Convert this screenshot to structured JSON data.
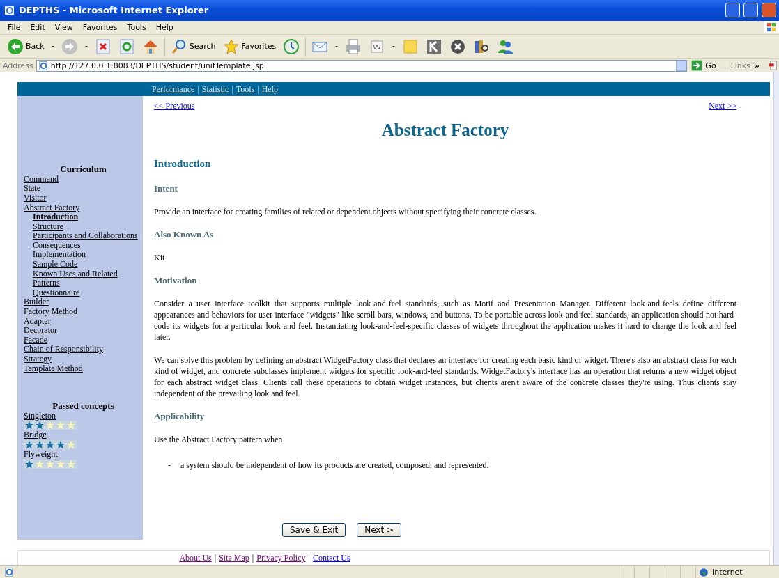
{
  "window": {
    "title": "DEPTHS - Microsoft Internet Explorer"
  },
  "menu_bar": [
    {
      "label": "File"
    },
    {
      "label": "Edit"
    },
    {
      "label": "View"
    },
    {
      "label": "Favorites"
    },
    {
      "label": "Tools"
    },
    {
      "label": "Help"
    }
  ],
  "toolbar": [
    {
      "kind": "back",
      "label": "Back",
      "dropdown": true
    },
    {
      "kind": "forward",
      "dropdown": true
    },
    {
      "kind": "stop"
    },
    {
      "kind": "refresh"
    },
    {
      "kind": "home"
    },
    {
      "kind": "sep"
    },
    {
      "kind": "search",
      "label": "Search"
    },
    {
      "kind": "favorites",
      "label": "Favorites"
    },
    {
      "kind": "history"
    },
    {
      "kind": "sep"
    },
    {
      "kind": "mail",
      "dropdown": true
    },
    {
      "kind": "print"
    },
    {
      "kind": "word",
      "dropdown": true
    },
    {
      "kind": "note"
    },
    {
      "kind": "k"
    },
    {
      "kind": "xcircle"
    },
    {
      "kind": "research"
    },
    {
      "kind": "messenger"
    }
  ],
  "address_bar": {
    "label": "Address",
    "url": "http://127.0.0.1:8083/DEPTHS/student/unitTemplate.jsp",
    "go": "Go",
    "links": "Links",
    "chevron": "»"
  },
  "nav_bar": [
    {
      "kind": "link",
      "label": "Performance"
    },
    {
      "kind": "separator",
      "label": "|"
    },
    {
      "kind": "link",
      "label": "Statistic"
    },
    {
      "kind": "separator",
      "label": "|"
    },
    {
      "kind": "link",
      "label": "Tools"
    },
    {
      "kind": "separator",
      "label": "|"
    },
    {
      "kind": "link",
      "label": "Help"
    }
  ],
  "pager": {
    "previous": "<< Previous",
    "next": "Next >>"
  },
  "sidebar": {
    "title": "Curriculum",
    "items": [
      {
        "label": "Command",
        "selected": false
      },
      {
        "label": "State",
        "selected": false
      },
      {
        "label": "Visitor",
        "selected": false
      },
      {
        "label": "Abstract Factory",
        "selected": false,
        "children": [
          {
            "label": "Introduction",
            "selected": true
          },
          {
            "label": "Structure",
            "selected": false
          },
          {
            "label": "Participants and Collaborations",
            "selected": false
          },
          {
            "label": "Consequences",
            "selected": false
          },
          {
            "label": "Implementation",
            "selected": false
          },
          {
            "label": "Sample Code",
            "selected": false
          },
          {
            "label": "Known Uses and Related Patterns",
            "selected": false
          },
          {
            "label": "Questionnaire",
            "selected": false
          }
        ]
      },
      {
        "label": "Builder",
        "selected": false
      },
      {
        "label": "Factory Method",
        "selected": false
      },
      {
        "label": "Adapter",
        "selected": false
      },
      {
        "label": "Decorator",
        "selected": false
      },
      {
        "label": "Facade",
        "selected": false
      },
      {
        "label": "Chain of Responsibility",
        "selected": false
      },
      {
        "label": "Strategy",
        "selected": false
      },
      {
        "label": "Template Method",
        "selected": false
      }
    ],
    "passed_title": "Passed concepts",
    "passed": [
      {
        "label": "Singleton",
        "stars": 2
      },
      {
        "label": "Bridge",
        "stars": 4
      },
      {
        "label": "Flyweight",
        "stars": 1
      }
    ]
  },
  "content": {
    "title": "Abstract Factory",
    "blocks": [
      {
        "kind": "section",
        "text": "Introduction"
      },
      {
        "kind": "subsection",
        "text": "Intent"
      },
      {
        "kind": "paragraph",
        "text": "Provide an interface for creating families of related or dependent objects without specifying their concrete classes."
      },
      {
        "kind": "subsection",
        "text": "Also Known As"
      },
      {
        "kind": "paragraph",
        "text": "Kit"
      },
      {
        "kind": "subsection",
        "text": "Motivation"
      },
      {
        "kind": "paragraph",
        "text": "Consider a user interface toolkit that supports multiple look-and-feel standards, such as Motif and Presentation Manager. Different look-and-feels define different appearances and behaviors for user interface \"widgets\" like scroll bars, windows, and buttons. To be portable across look-and-feel standards, an application should not hard-code its widgets for a particular look and feel. Instantiating look-and-feel-specific classes of widgets throughout the application makes it hard to change the look and feel later."
      },
      {
        "kind": "paragraph",
        "text": "We can solve this problem by defining an abstract WidgetFactory class that declares an interface for creating each basic kind of widget. There's also an abstract class for each kind of widget, and concrete subclasses implement widgets for specific look-and-feel standards. WidgetFactory's interface has an operation that returns a new widget object for each abstract widget class. Clients call these operations to obtain widget instances, but clients aren't aware of the concrete classes they're using. Thus clients stay independent of the prevailing look and feel."
      },
      {
        "kind": "subsection",
        "text": "Applicability"
      },
      {
        "kind": "paragraph",
        "text": "Use the Abstract Factory pattern when"
      },
      {
        "kind": "bullet",
        "marker": "-",
        "text": "a system should be independent of how its products are created, composed, and represented."
      }
    ],
    "buttons": [
      {
        "label": "Save & Exit"
      },
      {
        "label": "Next",
        "arrow": ">"
      }
    ]
  },
  "footer": [
    {
      "kind": "link",
      "label": "About Us",
      "visited": true
    },
    {
      "kind": "separator",
      "label": "|"
    },
    {
      "kind": "link",
      "label": "Site Map",
      "visited": true
    },
    {
      "kind": "separator",
      "label": "|"
    },
    {
      "kind": "link",
      "label": "Privacy Policy",
      "visited": true
    },
    {
      "kind": "separator",
      "label": "|"
    },
    {
      "kind": "link",
      "label": "Contact Us",
      "visited": false
    }
  ],
  "status_bar": {
    "zone": "Internet"
  }
}
